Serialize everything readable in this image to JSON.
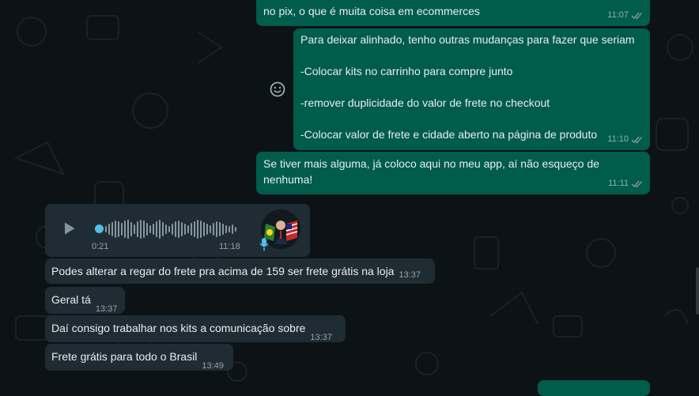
{
  "messages_out": [
    {
      "text": "no pix, o que é muita coisa em ecommerces",
      "time": "11:07"
    },
    {
      "text": "Para deixar alinhado, tenho outras mudanças para fazer que seriam\n\n-Colocar kits no carrinho para compre junto\n\n-remover duplicidade do valor de frete no checkout\n\n-Colocar valor de frete e cidade aberto na página de produto",
      "time": "11:10"
    },
    {
      "text": "Se tiver mais alguma, já coloco aqui no meu app, aí não esqueço de\nnenhuma!",
      "time": "11:11"
    }
  ],
  "voice_message": {
    "current_position": "0:21",
    "time": "11:18",
    "icon": "play-icon",
    "avatar": "profile-avatar"
  },
  "messages_in": [
    {
      "text": "Podes alterar a regar do frete pra acima de 159 ser frete grátis na loja",
      "time": "13:37"
    },
    {
      "text": "Geral tá",
      "time": "13:37"
    },
    {
      "text": "Daí consigo trabalhar nos kits a comunicação sobre",
      "time": "13:37"
    },
    {
      "text": "Frete grátis para todo o Brasil",
      "time": "13:49"
    }
  ],
  "colors": {
    "background": "#0c1317",
    "outgoing_bubble": "#005c4b",
    "incoming_bubble": "#202c33",
    "read_ticks": "#8696a0"
  }
}
